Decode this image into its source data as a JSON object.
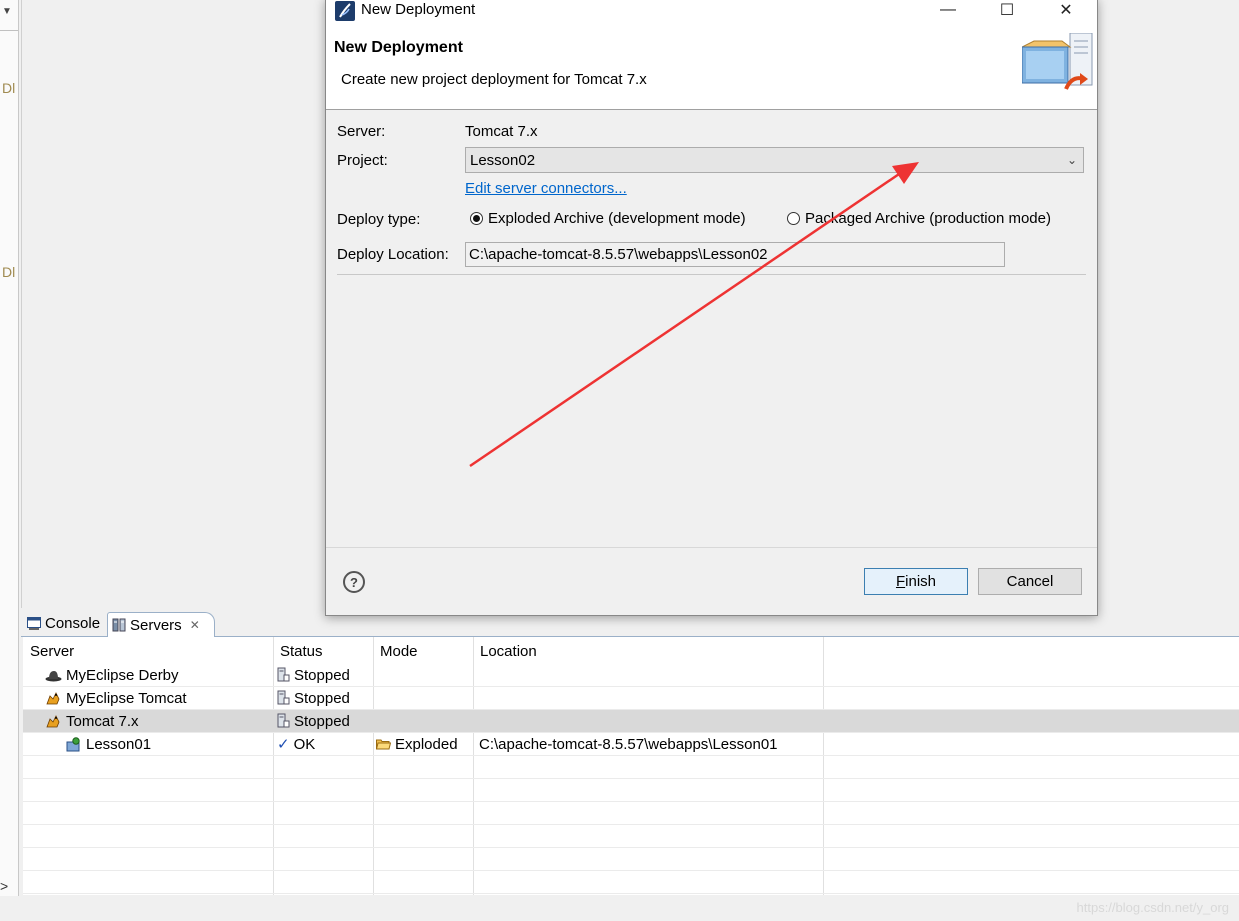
{
  "background": {
    "left_fragments": [
      "Dl",
      "Dl"
    ],
    "tabs": [
      {
        "label": "Console",
        "icon": "console-icon"
      },
      {
        "label": "Servers",
        "icon": "servers-icon",
        "close": "✕"
      }
    ],
    "table": {
      "headers": [
        "Server",
        "Status",
        "Mode",
        "Location"
      ],
      "rows": [
        {
          "server": "MyEclipse Derby",
          "icon": "derby-icon",
          "status": "Stopped",
          "mode": "",
          "location": "",
          "selected": false
        },
        {
          "server": "MyEclipse Tomcat",
          "icon": "tomcat-icon",
          "status": "Stopped",
          "mode": "",
          "location": "",
          "selected": false
        },
        {
          "server": "Tomcat  7.x",
          "icon": "tomcat-icon",
          "status": "Stopped",
          "mode": "",
          "location": "",
          "selected": true
        },
        {
          "server": "Lesson01",
          "icon": "project-icon",
          "status": "OK",
          "mode": "Exploded",
          "location": "C:\\apache-tomcat-8.5.57\\webapps\\Lesson01",
          "selected": false
        }
      ]
    },
    "watermark": "https://blog.csdn.net/y_org"
  },
  "dialog": {
    "window_title": "New Deployment",
    "header_title": "New Deployment",
    "header_desc": "Create new project deployment for Tomcat  7.x",
    "server_label": "Server:",
    "server_value": "Tomcat  7.x",
    "project_label": "Project:",
    "project_value": "Lesson02",
    "edit_connectors": "Edit server connectors...",
    "deploy_type_label": "Deploy type:",
    "deploy_options": [
      {
        "label": "Exploded Archive (development mode)",
        "selected": true
      },
      {
        "label": "Packaged Archive (production mode)",
        "selected": false
      }
    ],
    "deploy_location_label": "Deploy Location:",
    "deploy_location_value": "C:\\apache-tomcat-8.5.57\\webapps\\Lesson02",
    "help": "?",
    "finish_prefix": "F",
    "finish_rest": "inish",
    "cancel": "Cancel"
  },
  "colors": {
    "annotation_arrow": "#ee3333",
    "link": "#0066cc",
    "selection": "#d9d9d9"
  }
}
